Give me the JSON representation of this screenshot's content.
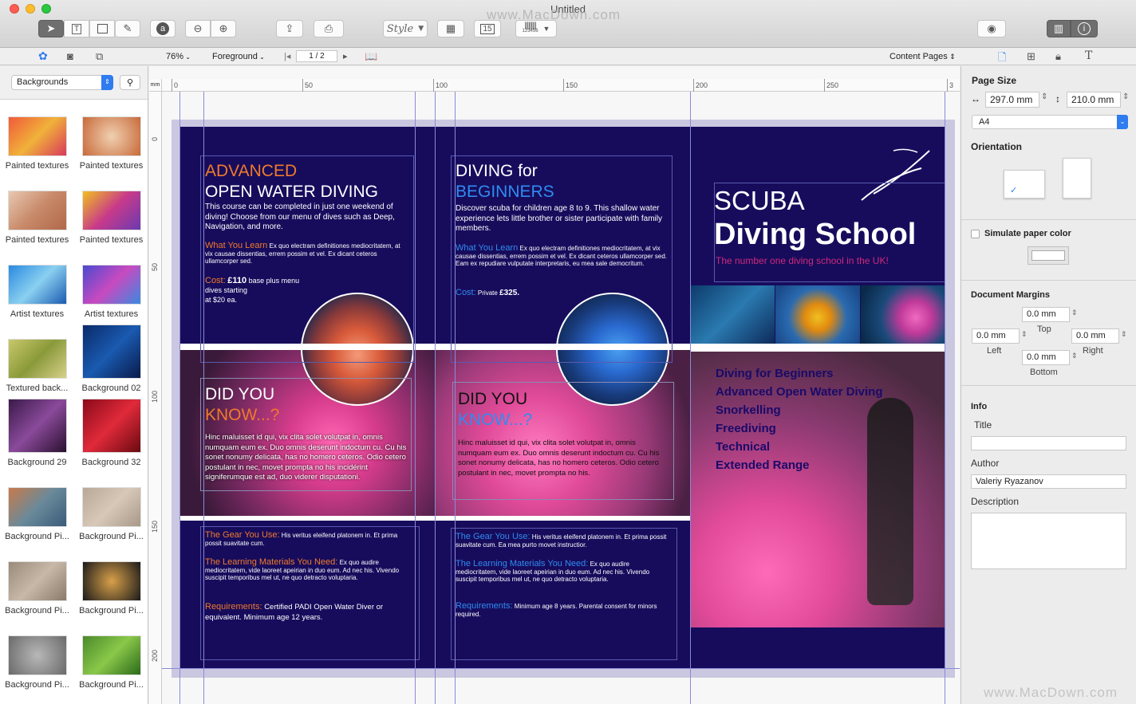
{
  "window": {
    "title": "Untitled",
    "watermark": "www.MacDown.com",
    "watermark_bottom": "www.MacDown.com"
  },
  "toolbar": {
    "style_label": "Style",
    "barcode_number": "123456"
  },
  "subbar": {
    "zoom": "76%",
    "layer": "Foreground",
    "page_indicator": "1 / 2",
    "content_pages": "Content Pages"
  },
  "library": {
    "category": "Backgrounds",
    "items": [
      {
        "label": "Painted textures"
      },
      {
        "label": "Painted textures"
      },
      {
        "label": "Painted textures"
      },
      {
        "label": "Painted textures"
      },
      {
        "label": "Artist textures"
      },
      {
        "label": "Artist textures"
      },
      {
        "label": "Textured back..."
      },
      {
        "label": "Background 02"
      },
      {
        "label": "Background 29"
      },
      {
        "label": "Background 32"
      },
      {
        "label": "Background Pi..."
      },
      {
        "label": "Background Pi..."
      },
      {
        "label": "Background Pi..."
      },
      {
        "label": "Background Pi..."
      },
      {
        "label": "Background Pi..."
      },
      {
        "label": "Background Pi..."
      }
    ]
  },
  "ruler": {
    "unit": "mm",
    "h_ticks": [
      "0",
      "50",
      "100",
      "150",
      "200",
      "250",
      "3"
    ],
    "v_ticks": [
      "0",
      "50",
      "100",
      "150",
      "200"
    ]
  },
  "doc": {
    "p1": {
      "h1a": "ADVANCED",
      "h1b": "OPEN WATER DIVING",
      "intro": "This course can be completed in just one weekend of diving! Choose from our menu of dives such as Deep, Navigation, and more.",
      "learn_h": "What You Learn",
      "learn": "Ex quo electram definitiones mediocritatem, at vix causae dissentias, errem possim et vel. Ex dicant ceteros ullamcorper sed.",
      "cost_h": "Cost:",
      "cost_price": "£110",
      "cost_rest": "base plus menu",
      "cost_l2": "dives starting",
      "cost_l3": "at $20 ea.",
      "dyk_a": "DID YOU",
      "dyk_b": "KNOW...?",
      "dyk_text": "Hinc maluisset id qui, vix clita solet volutpat in, omnis numquam eum ex. Duo omnis deserunt indoctum cu. Cu his sonet nonumy delicata, has no homero ceteros. Odio cetero postulant in nec, movet prompta no his incidérint signiferumque est ad, duo viderer disputationi.",
      "gear_h": "The Gear You Use:",
      "gear": "His veritus eleifend platonem in. Et prima possit suavitate cum.",
      "mat_h": "The Learning Materials You Need:",
      "mat": "Ex quo audire mediocritatem, vide laoreet apeirian in duo eum. Ad nec his. Vivendo suscipit temporibus mel ut, ne quo detracto voluptaria.",
      "req_h": "Requirements:",
      "req": "Certified PADI Open Water Diver or equivalent. Minimum age 12 years."
    },
    "p2": {
      "h1a": "DIVING for",
      "h1b": "BEGINNERS",
      "intro": "Discover scuba for children age 8 to 9. This shallow water experience lets little brother or sister participate with family members.",
      "learn_h": "What You Learn",
      "learn": "Ex quo electram definitiones mediocritatem, at vix causae dissentias, errem possim et vel. Ex dicant ceteros ullamcorper sed. Eam ex repudiare vulputate interpretaris, eu mea sale democritum.",
      "cost_h": "Cost:",
      "cost_rest": "Private",
      "cost_price": "£325.",
      "dyk_a": "DID YOU",
      "dyk_b": "KNOW...?",
      "dyk_text": "Hinc maluisset id qui, vix clita solet volutpat in, omnis numquam eum ex. Duo omnis deserunt indoctum cu. Cu his sonet nonumy delicata, has no homero ceteros. Odio cetero postulant in nec, movet prompta no his.",
      "gear_h": "The Gear You Use:",
      "gear": "His veritus eleifend platonem in. Et prima possit suavitate cum. Ea mea purto movet instructior.",
      "mat_h": "The Learning Materials You Need:",
      "mat": "Ex quo audire mediocritatem, vide laoreet apeirian in duo eum. Ad nec his. Vivendo suscipit temporibus mel ut, ne quo detracto voluptaria.",
      "req_h": "Requirements:",
      "req": "Minimum age 8 years. Parental consent for minors required."
    },
    "p3": {
      "scuba": "SCUBA",
      "school": "Diving School",
      "tagline": "The number one diving school in the UK!",
      "courses": [
        "Diving for Beginners",
        "Advanced Open Water Diving",
        "Snorkelling",
        "Freediving",
        "Technical",
        "Extended Range"
      ]
    }
  },
  "inspector": {
    "page_size_title": "Page Size",
    "width": "297.0 mm",
    "height": "210.0 mm",
    "paper": "A4",
    "orientation_title": "Orientation",
    "simulate_label": "Simulate paper color",
    "margins_title": "Document Margins",
    "top": "0.0 mm",
    "left": "0.0 mm",
    "right": "0.0 mm",
    "bottom": "0.0 mm",
    "top_lbl": "Top",
    "left_lbl": "Left",
    "right_lbl": "Right",
    "bottom_lbl": "Bottom",
    "info_title": "Info",
    "title_lbl": "Title",
    "title_val": "",
    "author_lbl": "Author",
    "author_val": "Valeriy Ryazanov",
    "desc_lbl": "Description"
  },
  "colors": {
    "navy": "#170c5c",
    "orange": "#f07a2a",
    "blue": "#2f8cf0",
    "pink": "#d0287a",
    "guide": "#8a8ad8"
  }
}
